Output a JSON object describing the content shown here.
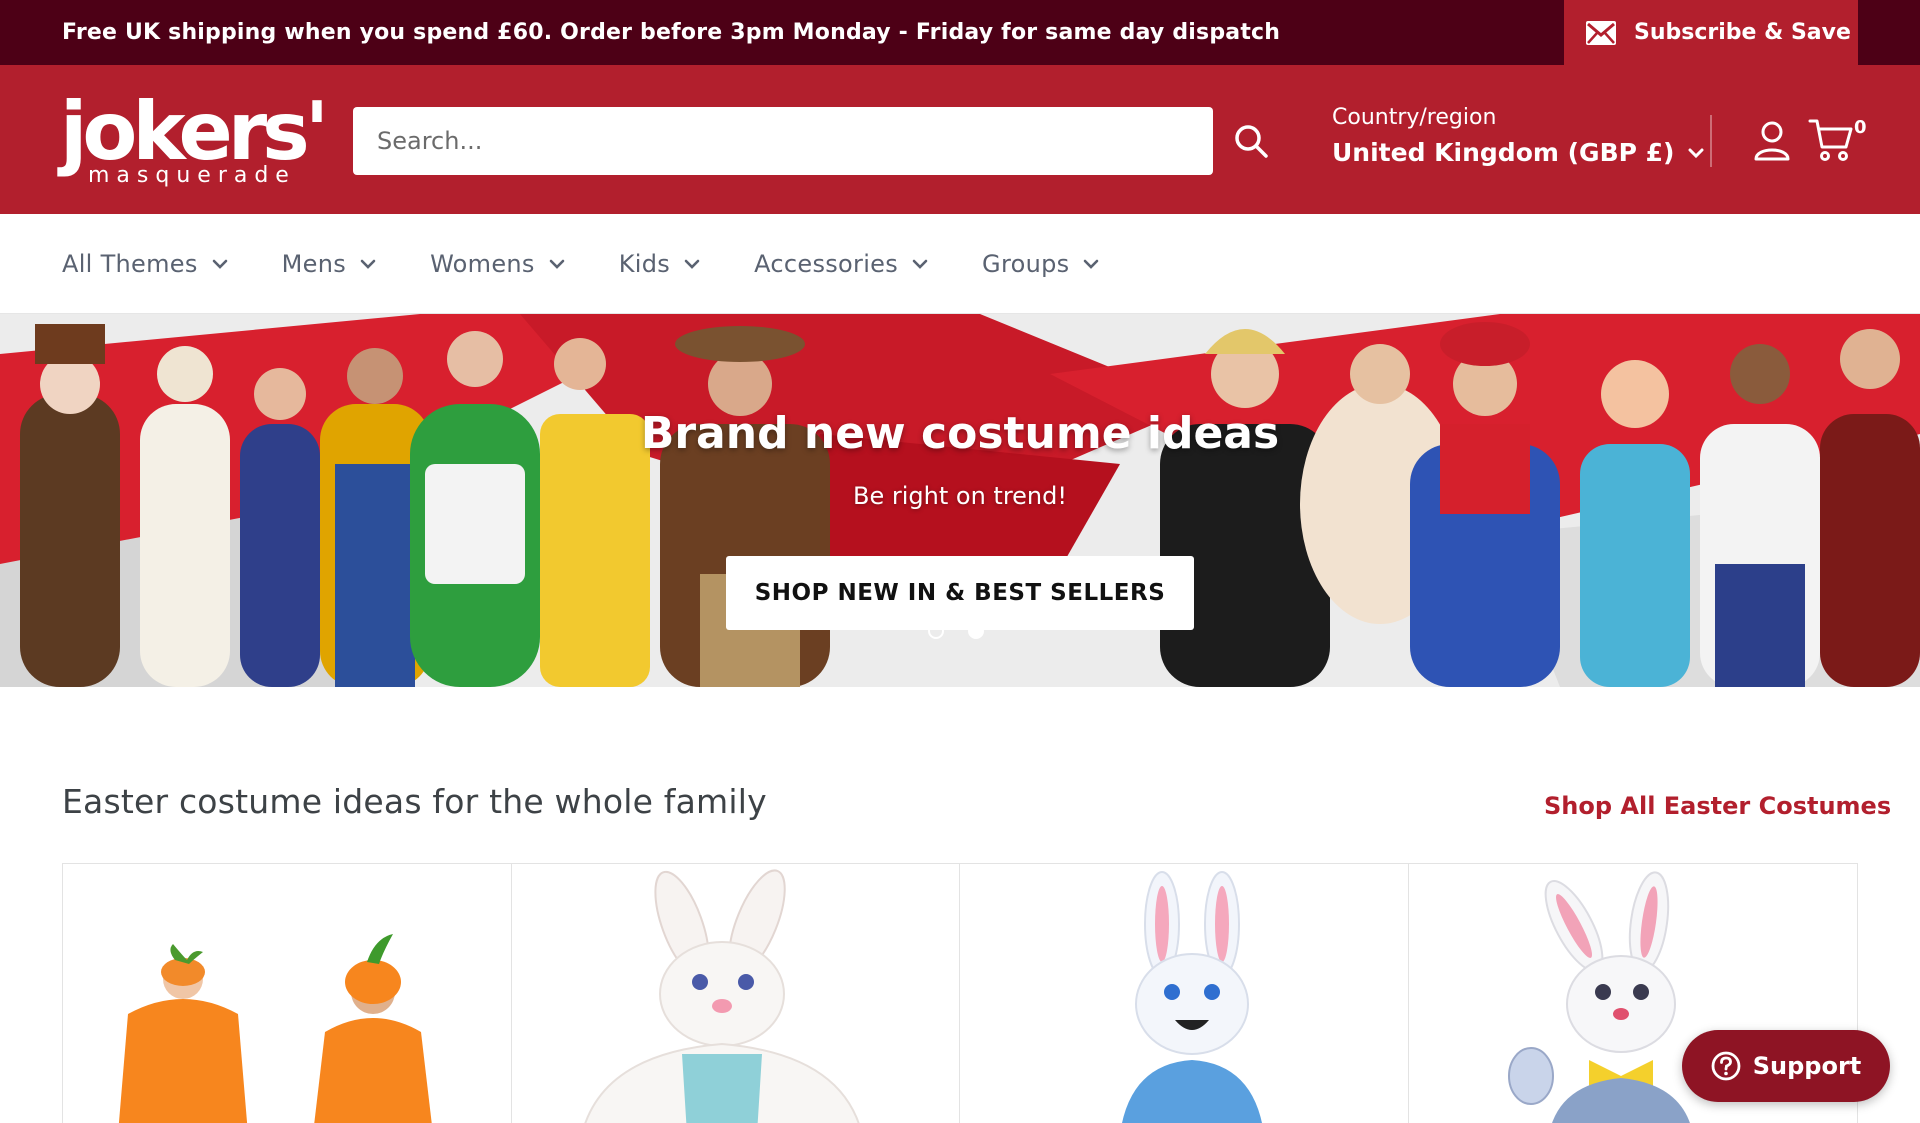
{
  "announcement": {
    "message": "Free UK shipping when you spend £60. Order before 3pm Monday - Friday for same day dispatch",
    "subscribe_label": "Subscribe & Save"
  },
  "header": {
    "logo_word": "jokers'",
    "logo_sub": "masquerade",
    "search_placeholder": "Search...",
    "country_label": "Country/region",
    "country_value": "United Kingdom (GBP £)",
    "cart_count": "0"
  },
  "nav": {
    "items": [
      {
        "label": "All Themes"
      },
      {
        "label": "Mens"
      },
      {
        "label": "Womens"
      },
      {
        "label": "Kids"
      },
      {
        "label": "Accessories"
      },
      {
        "label": "Groups"
      }
    ]
  },
  "hero": {
    "title": "Brand new costume ideas",
    "tagline": "Be right on trend!",
    "cta_label": "SHOP NEW IN & BEST SELLERS",
    "slides": 2,
    "active_slide": 2
  },
  "section": {
    "title": "Easter costume ideas for the whole family",
    "link_label": "Shop All Easter Costumes"
  },
  "products": [
    {
      "icon": "carrot-costume-image"
    },
    {
      "icon": "bunny-mascot-image"
    },
    {
      "icon": "blue-bunny-mascot-image"
    },
    {
      "icon": "white-bunny-mascot-image"
    }
  ],
  "support": {
    "label": "Support"
  },
  "colors": {
    "topbar": "#4d0016",
    "brand_red": "#b21f2d",
    "support": "#8e1424"
  }
}
